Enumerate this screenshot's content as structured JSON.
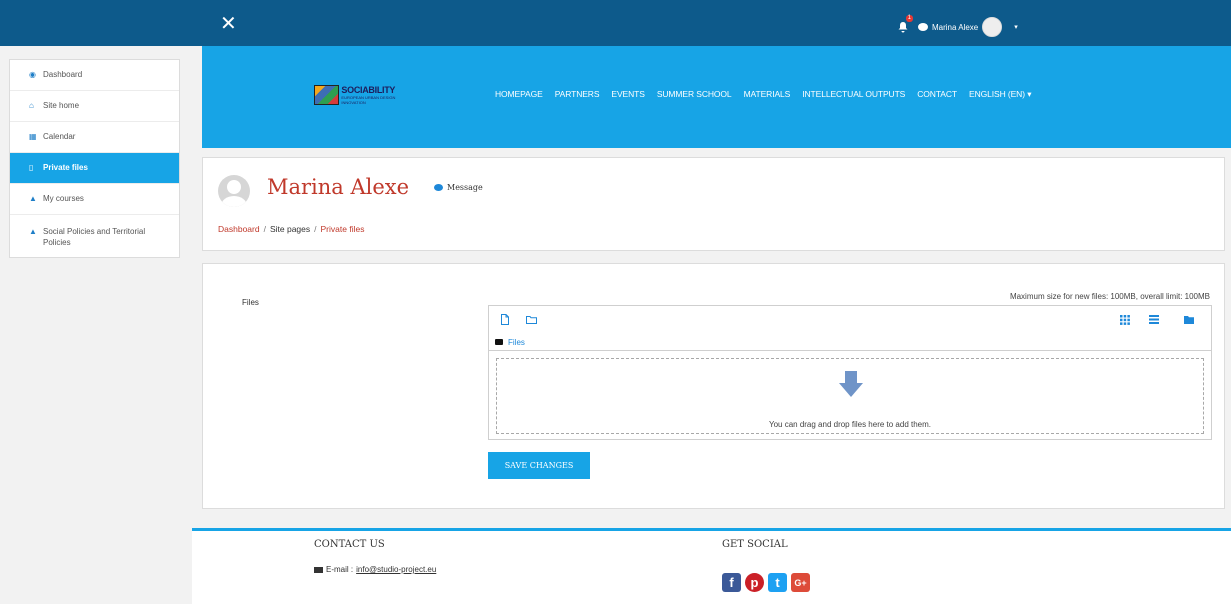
{
  "topbar": {
    "close_glyph": "✕",
    "notifications_count": "1",
    "user_name": "Marina Alexe",
    "menu_caret": "▾"
  },
  "drawer": {
    "items": [
      {
        "label": "Dashboard",
        "icon": "dashboard-icon",
        "glyph": "◉"
      },
      {
        "label": "Site home",
        "icon": "home-icon",
        "glyph": "⌂"
      },
      {
        "label": "Calendar",
        "icon": "calendar-icon",
        "glyph": "▦"
      },
      {
        "label": "Private files",
        "icon": "file-icon",
        "glyph": "▯",
        "active": true
      },
      {
        "label": "My courses",
        "icon": "graduation-cap-icon",
        "glyph": "▲"
      },
      {
        "label": "Social Policies and Territorial Policies",
        "icon": "graduation-cap-icon",
        "glyph": "▲"
      }
    ]
  },
  "header": {
    "logo_text": "SOCIABILITY",
    "logo_subtext": "EUROPEAN URBAN DESIGN INNOVATION",
    "nav": [
      "HOMEPAGE",
      "PARTNERS",
      "EVENTS",
      "SUMMER SCHOOL",
      "MATERIALS",
      "INTELLECTUAL OUTPUTS",
      "CONTACT",
      "ENGLISH (EN) ▾"
    ]
  },
  "profile": {
    "name": "Marina Alexe",
    "message_label": "Message",
    "breadcrumb": [
      "Dashboard",
      "Site pages",
      "Private files"
    ],
    "breadcrumb_sep": "/"
  },
  "files": {
    "label": "Files",
    "max_size": "Maximum size for new files: 100MB, overall limit: 100MB",
    "path_label": "Files",
    "drop_text": "You can drag and drop files here to add them.",
    "save_label": "SAVE CHANGES"
  },
  "footer": {
    "contact_title": "CONTACT US",
    "email_label": "E-mail :",
    "email": "info@studio-project.eu",
    "social_title": "GET SOCIAL",
    "social": [
      {
        "name": "facebook-icon",
        "glyph": "f",
        "color": "#3b5998"
      },
      {
        "name": "pinterest-icon",
        "glyph": "p",
        "color": "#cb2027"
      },
      {
        "name": "twitter-icon",
        "glyph": "t",
        "color": "#1da1f2"
      },
      {
        "name": "google-plus-icon",
        "glyph": "G+",
        "color": "#dd4b39"
      }
    ]
  },
  "colors": {
    "navbar": "#0d5a8b",
    "accent": "#17a4e6",
    "brand_red": "#c0392b"
  }
}
